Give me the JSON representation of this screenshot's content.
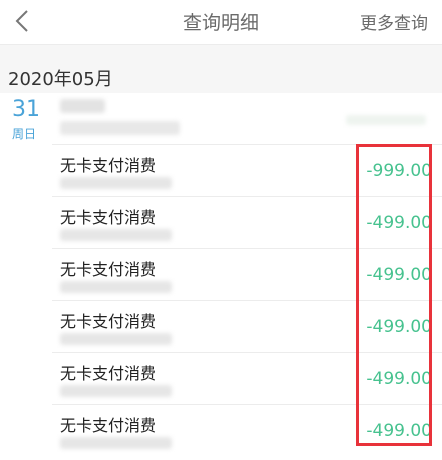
{
  "nav": {
    "title": "查询明细",
    "more": "更多查询",
    "back_icon": "chevron-left-icon"
  },
  "month": "2020年05月",
  "day": {
    "number": "31",
    "weekday": "周日"
  },
  "transactions": [
    {
      "title": "无卡支付消费",
      "amount": "-999.00"
    },
    {
      "title": "无卡支付消费",
      "amount": "-499.00"
    },
    {
      "title": "无卡支付消费",
      "amount": "-499.00"
    },
    {
      "title": "无卡支付消费",
      "amount": "-499.00"
    },
    {
      "title": "无卡支付消费",
      "amount": "-499.00"
    },
    {
      "title": "无卡支付消费",
      "amount": "-499.00"
    }
  ],
  "colors": {
    "accent": "#4aa3d8",
    "amount": "#47c28f",
    "highlight": "#e8323a"
  }
}
